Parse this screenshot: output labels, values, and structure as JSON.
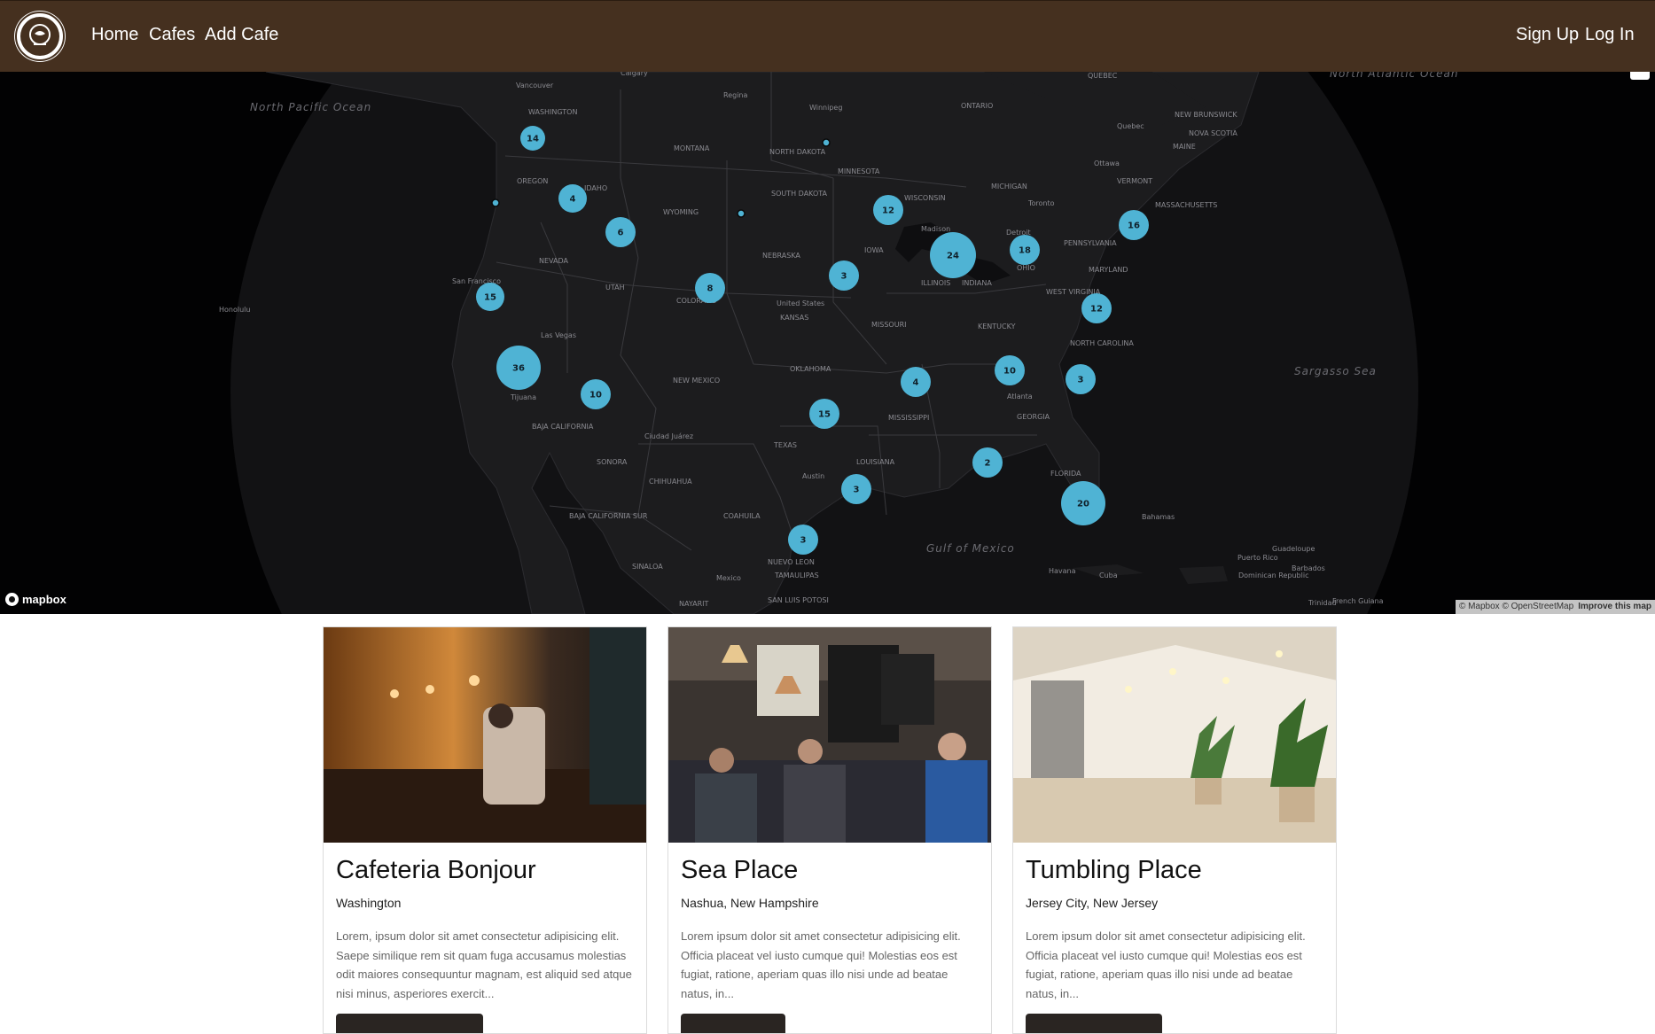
{
  "nav": {
    "brand_icon": "coffee-cup-logo-icon",
    "links": [
      "Home",
      "Cafes",
      "Add Cafe"
    ],
    "auth": [
      "Sign Up",
      "Log In"
    ]
  },
  "map": {
    "provider_logo": "mapbox",
    "attribution": "© Mapbox © OpenStreetMap",
    "improve": "Improve this map",
    "clusters": [
      {
        "count": "14"
      },
      {
        "count": "4"
      },
      {
        "count": "6"
      },
      {
        "count": "15"
      },
      {
        "count": "36"
      },
      {
        "count": "10"
      },
      {
        "count": "8"
      },
      {
        "count": "3"
      },
      {
        "count": "12"
      },
      {
        "count": "24"
      },
      {
        "count": "18"
      },
      {
        "count": "16"
      },
      {
        "count": "12"
      },
      {
        "count": "10"
      },
      {
        "count": "3"
      },
      {
        "count": "4"
      },
      {
        "count": "15"
      },
      {
        "count": "2"
      },
      {
        "count": "3"
      },
      {
        "count": "20"
      },
      {
        "count": "3"
      }
    ],
    "place_labels": [
      "Calgary",
      "Vancouver",
      "Regina",
      "Winnipeg",
      "QUEBEC",
      "ONTARIO",
      "WASHINGTON",
      "MONTANA",
      "NORTH DAKOTA",
      "MINNESOTA",
      "Quebec",
      "Ottawa",
      "OREGON",
      "IDAHO",
      "WYOMING",
      "SOUTH DAKOTA",
      "WISCONSIN",
      "MICHIGAN",
      "Toronto",
      "VERMONT",
      "NEW BRUNSWICK",
      "NOVA SCOTIA",
      "MAINE",
      "MASSACHUSETTS",
      "NEVADA",
      "UTAH",
      "NEBRASKA",
      "IOWA",
      "Madison",
      "Detroit",
      "PENNSYLVANIA",
      "San Francisco",
      "COLORADO",
      "United States",
      "KANSAS",
      "ILLINOIS",
      "INDIANA",
      "OHIO",
      "MARYLAND",
      "WEST VIRGINIA",
      "Las Vegas",
      "MISSOURI",
      "KENTUCKY",
      "NORTH CAROLINA",
      "OKLAHOMA",
      "Tijuana",
      "NEW MEXICO",
      "Atlanta",
      "BAJA CALIFORNIA",
      "Ciudad Juárez",
      "TEXAS",
      "MISSISSIPPI",
      "GEORGIA",
      "SONORA",
      "CHIHUAHUA",
      "Austin",
      "LOUISIANA",
      "FLORIDA",
      "BAJA CALIFORNIA SUR",
      "COAHUILA",
      "Bahamas",
      "NUEVO LEON",
      "Havana",
      "Cuba",
      "Puerto Rico",
      "Guadeloupe",
      "Barbados",
      "SINALOA",
      "Mexico",
      "TAMAULIPAS",
      "Dominican Republic",
      "Honolulu",
      "NAYARIT",
      "SAN LUIS POTOSI",
      "Trinidad",
      "French Guiana"
    ],
    "ocean_labels": [
      "North Pacific Ocean",
      "North Atlantic Ocean",
      "Sargasso Sea",
      "Gulf of Mexico"
    ]
  },
  "cards": [
    {
      "title": "Cafeteria Bonjour",
      "location": "Washington",
      "description": "Lorem, ipsum dolor sit amet consectetur adipisicing elit. Saepe similique rem sit quam fuga accusamus molestias odit maiores consequuntur magnam, est aliquid sed atque nisi minus, asperiores exercit..."
    },
    {
      "title": "Sea Place",
      "location": "Nashua, New Hampshire",
      "description": "Lorem ipsum dolor sit amet consectetur adipisicing elit. Officia placeat vel iusto cumque qui! Molestias eos est fugiat, ratione, aperiam quas illo nisi unde ad beatae natus, in..."
    },
    {
      "title": "Tumbling Place",
      "location": "Jersey City, New Jersey",
      "description": "Lorem ipsum dolor sit amet consectetur adipisicing elit. Officia placeat vel iusto cumque qui! Molestias eos est fugiat, ratione, aperiam quas illo nisi unde ad beatae natus, in..."
    }
  ],
  "colors": {
    "navbar": "#45301f",
    "map_background": "#020203",
    "land": "#1a1a1c",
    "cluster": "#4fb3d4",
    "button": "#2a2522"
  }
}
